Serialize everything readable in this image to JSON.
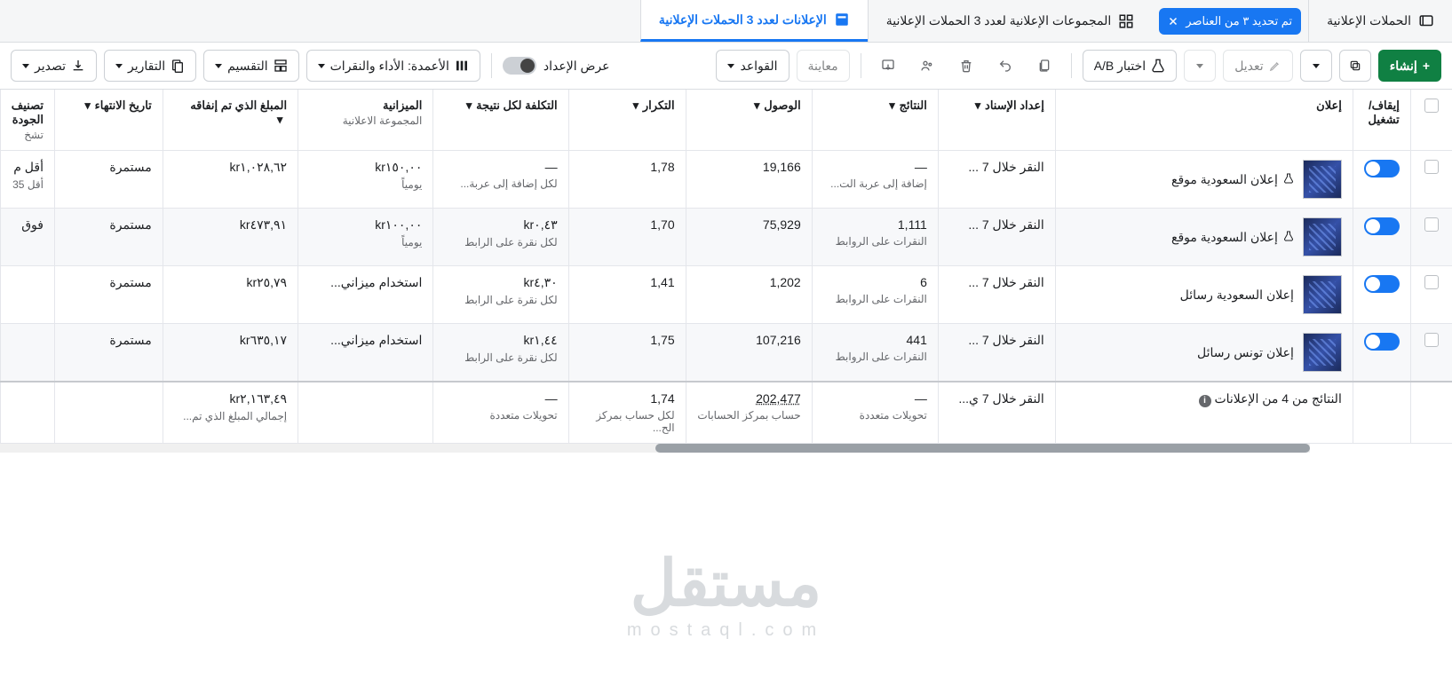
{
  "tabs": {
    "campaigns": {
      "label": "الحملات الإعلانية"
    },
    "adsets": {
      "label": "المجموعات الإعلانية لعدد 3 الحملات الإعلانية"
    },
    "ads": {
      "label": "الإعلانات لعدد 3 الحملات الإعلانية"
    }
  },
  "selection_chip": {
    "label": "تم تحديد ٣ من العناصر"
  },
  "toolbar": {
    "create": "إنشاء",
    "edit": "تعديل",
    "ab_test": "اختبار A/B",
    "preview": "معاينة",
    "rules": "القواعد",
    "view_settings": "عرض الإعداد",
    "columns": "الأعمدة: الأداء والنقرات",
    "breakdown": "التقسيم",
    "reports": "التقارير",
    "export": "تصدير"
  },
  "columns": {
    "toggle_header": "إيقاف/تشغيل",
    "ad": "إعلان",
    "attribution": "إعداد الإسناد",
    "results": "النتائج",
    "reach": "الوصول",
    "frequency": "التكرار",
    "cost_per_result": "التكلفة لكل نتيجة",
    "budget": "الميزانية",
    "budget_sub": "المجموعة الاعلانية",
    "spent": "المبلغ الذي تم إنفاقه",
    "end_date": "تاريخ الانتهاء",
    "quality": "تصنيف الجودة",
    "quality_sub": "تشخ"
  },
  "rows": [
    {
      "name": "إعلان السعودية موقع",
      "has_flask": true,
      "attribution": "النقر خلال 7 ...",
      "results": "—",
      "results_sub": "إضافة إلى عربة الت...",
      "reach": "19,166",
      "frequency": "1,78",
      "cpr": "—",
      "cpr_sub": "لكل إضافة إلى عربة...",
      "budget": "kr١٥٠,٠٠",
      "budget_sub": "يومياً",
      "spent": "kr١,٠٢٨,٦٢",
      "end": "مستمرة",
      "quality": "أقل م",
      "quality_sub": "أقل 35"
    },
    {
      "name": "إعلان السعودية موقع",
      "has_flask": true,
      "attribution": "النقر خلال 7 ...",
      "results": "1,111",
      "results_sub": "النقرات على الروابط",
      "reach": "75,929",
      "frequency": "1,70",
      "cpr": "kr٠,٤٣",
      "cpr_sub": "لكل نقرة على الرابط",
      "budget": "kr١٠٠,٠٠",
      "budget_sub": "يومياً",
      "spent": "kr٤٧٣,٩١",
      "end": "مستمرة",
      "quality": "فوق"
    },
    {
      "name": "إعلان السعودية رسائل",
      "has_flask": false,
      "attribution": "النقر خلال 7 ...",
      "results": "6",
      "results_sub": "النقرات على الروابط",
      "reach": "1,202",
      "frequency": "1,41",
      "cpr": "kr٤,٣٠",
      "cpr_sub": "لكل نقرة على الرابط",
      "budget": "استخدام ميزاني...",
      "budget_sub": "",
      "spent": "kr٢٥,٧٩",
      "end": "مستمرة",
      "quality": ""
    },
    {
      "name": "إعلان تونس رسائل",
      "has_flask": false,
      "attribution": "النقر خلال 7 ...",
      "results": "441",
      "results_sub": "النقرات على الروابط",
      "reach": "107,216",
      "frequency": "1,75",
      "cpr": "kr١,٤٤",
      "cpr_sub": "لكل نقرة على الرابط",
      "budget": "استخدام ميزاني...",
      "budget_sub": "",
      "spent": "kr٦٣٥,١٧",
      "end": "مستمرة",
      "quality": ""
    }
  ],
  "footer": {
    "summary_label": "النتائج من 4 من الإعلانات",
    "attribution": "النقر خلال 7 ي...",
    "results": "—",
    "results_sub": "تحويلات متعددة",
    "reach": "202,477",
    "reach_sub": "حساب بمركز الحسابات",
    "frequency": "1,74",
    "frequency_sub": "لكل حساب بمركز الح...",
    "cpr": "—",
    "cpr_sub": "تحويلات متعددة",
    "spent": "kr٢,١٦٣,٤٩",
    "spent_sub": "إجمالي المبلغ الذي تم..."
  },
  "watermark": {
    "big": "مستقل",
    "small": "mostaql.com"
  }
}
